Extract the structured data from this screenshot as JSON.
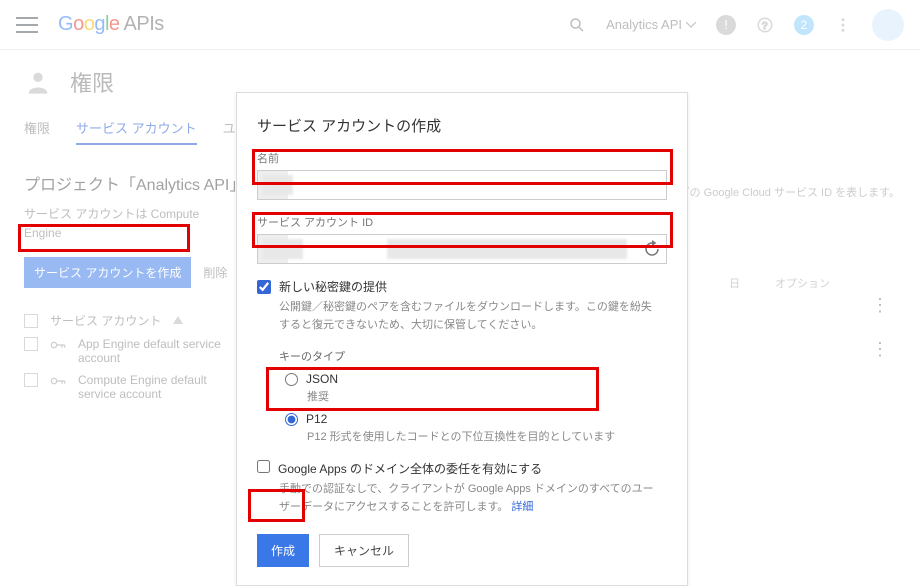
{
  "header": {
    "logo_apis": "APIs",
    "project_name": "Analytics API",
    "badge_count": "2"
  },
  "bg": {
    "title": "権限",
    "tabs": {
      "t1": "権限",
      "t2": "サービス アカウント",
      "t3": "ユーザ"
    },
    "project_line": "プロジェクト「Analytics API」",
    "project_desc": "サービス アカウントは Compute Engine",
    "project_desc_tail": "などの Google Cloud サービス ID を表します。",
    "create_btn": "サービス アカウントを作成",
    "delete_btn": "削除",
    "list_head": "サービス アカウント",
    "item1": "App Engine default service account",
    "item2": "Compute Engine default service account",
    "col_date": "日",
    "col_options": "オプション"
  },
  "modal": {
    "title": "サービス アカウントの作成",
    "name_label": "名前",
    "name_value": "",
    "id_label": "サービス アカウント ID",
    "id_value": "",
    "new_key_label": "新しい秘密鍵の提供",
    "new_key_desc": "公開鍵／秘密鍵のペアを含むファイルをダウンロードします。この鍵を紛失すると復元できないため、大切に保管してください。",
    "key_type_label": "キーのタイプ",
    "json_label": "JSON",
    "json_sub": "推奨",
    "p12_label": "P12",
    "p12_sub": "P12 形式を使用したコードとの下位互換性を目的としています",
    "domain_label": "Google Apps のドメイン全体の委任を有効にする",
    "domain_desc_a": "手動での認証なしで、クライアントが Google Apps ドメインのすべてのユーザーデータにアクセスすることを許可します。",
    "domain_link": "詳細",
    "create": "作成",
    "cancel": "キャンセル"
  }
}
